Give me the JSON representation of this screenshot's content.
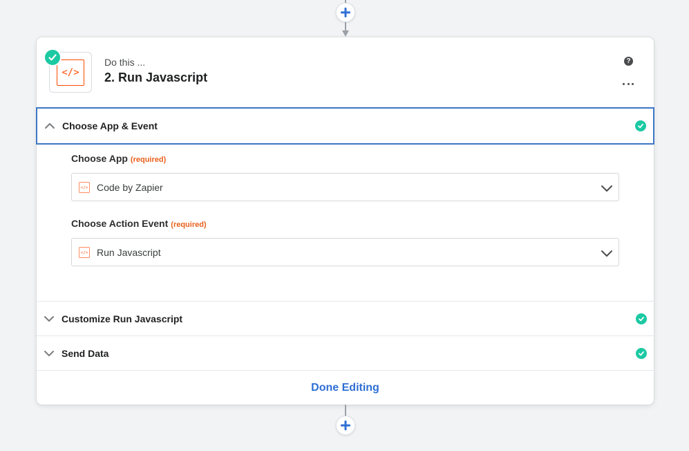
{
  "step": {
    "subtitle": "Do this ...",
    "title": "2. Run Javascript",
    "app_icon_glyph": "</>",
    "help_glyph": "?"
  },
  "sections": [
    {
      "label": "Choose App & Event",
      "expanded": true,
      "complete": true
    },
    {
      "label": "Customize Run Javascript",
      "expanded": false,
      "complete": true
    },
    {
      "label": "Send Data",
      "expanded": false,
      "complete": true
    }
  ],
  "fields": {
    "app": {
      "label": "Choose App",
      "required": "(required)",
      "value": "Code by Zapier",
      "icon_glyph": "</>"
    },
    "event": {
      "label": "Choose Action Event",
      "required": "(required)",
      "value": "Run Javascript",
      "icon_glyph": "</>"
    }
  },
  "footer": {
    "done_label": "Done Editing"
  },
  "colors": {
    "accent_blue": "#2f6fd4",
    "success_green": "#1bc9a3",
    "code_orange": "#ff4a00",
    "required_orange": "#e8601c",
    "active_border": "#3d76c4"
  },
  "icons": {
    "add_step_top": "plus-icon",
    "add_step_bottom": "plus-icon",
    "status": "check-icon",
    "help": "help-icon",
    "more": "more-icon",
    "expand": "chevron-icon"
  }
}
